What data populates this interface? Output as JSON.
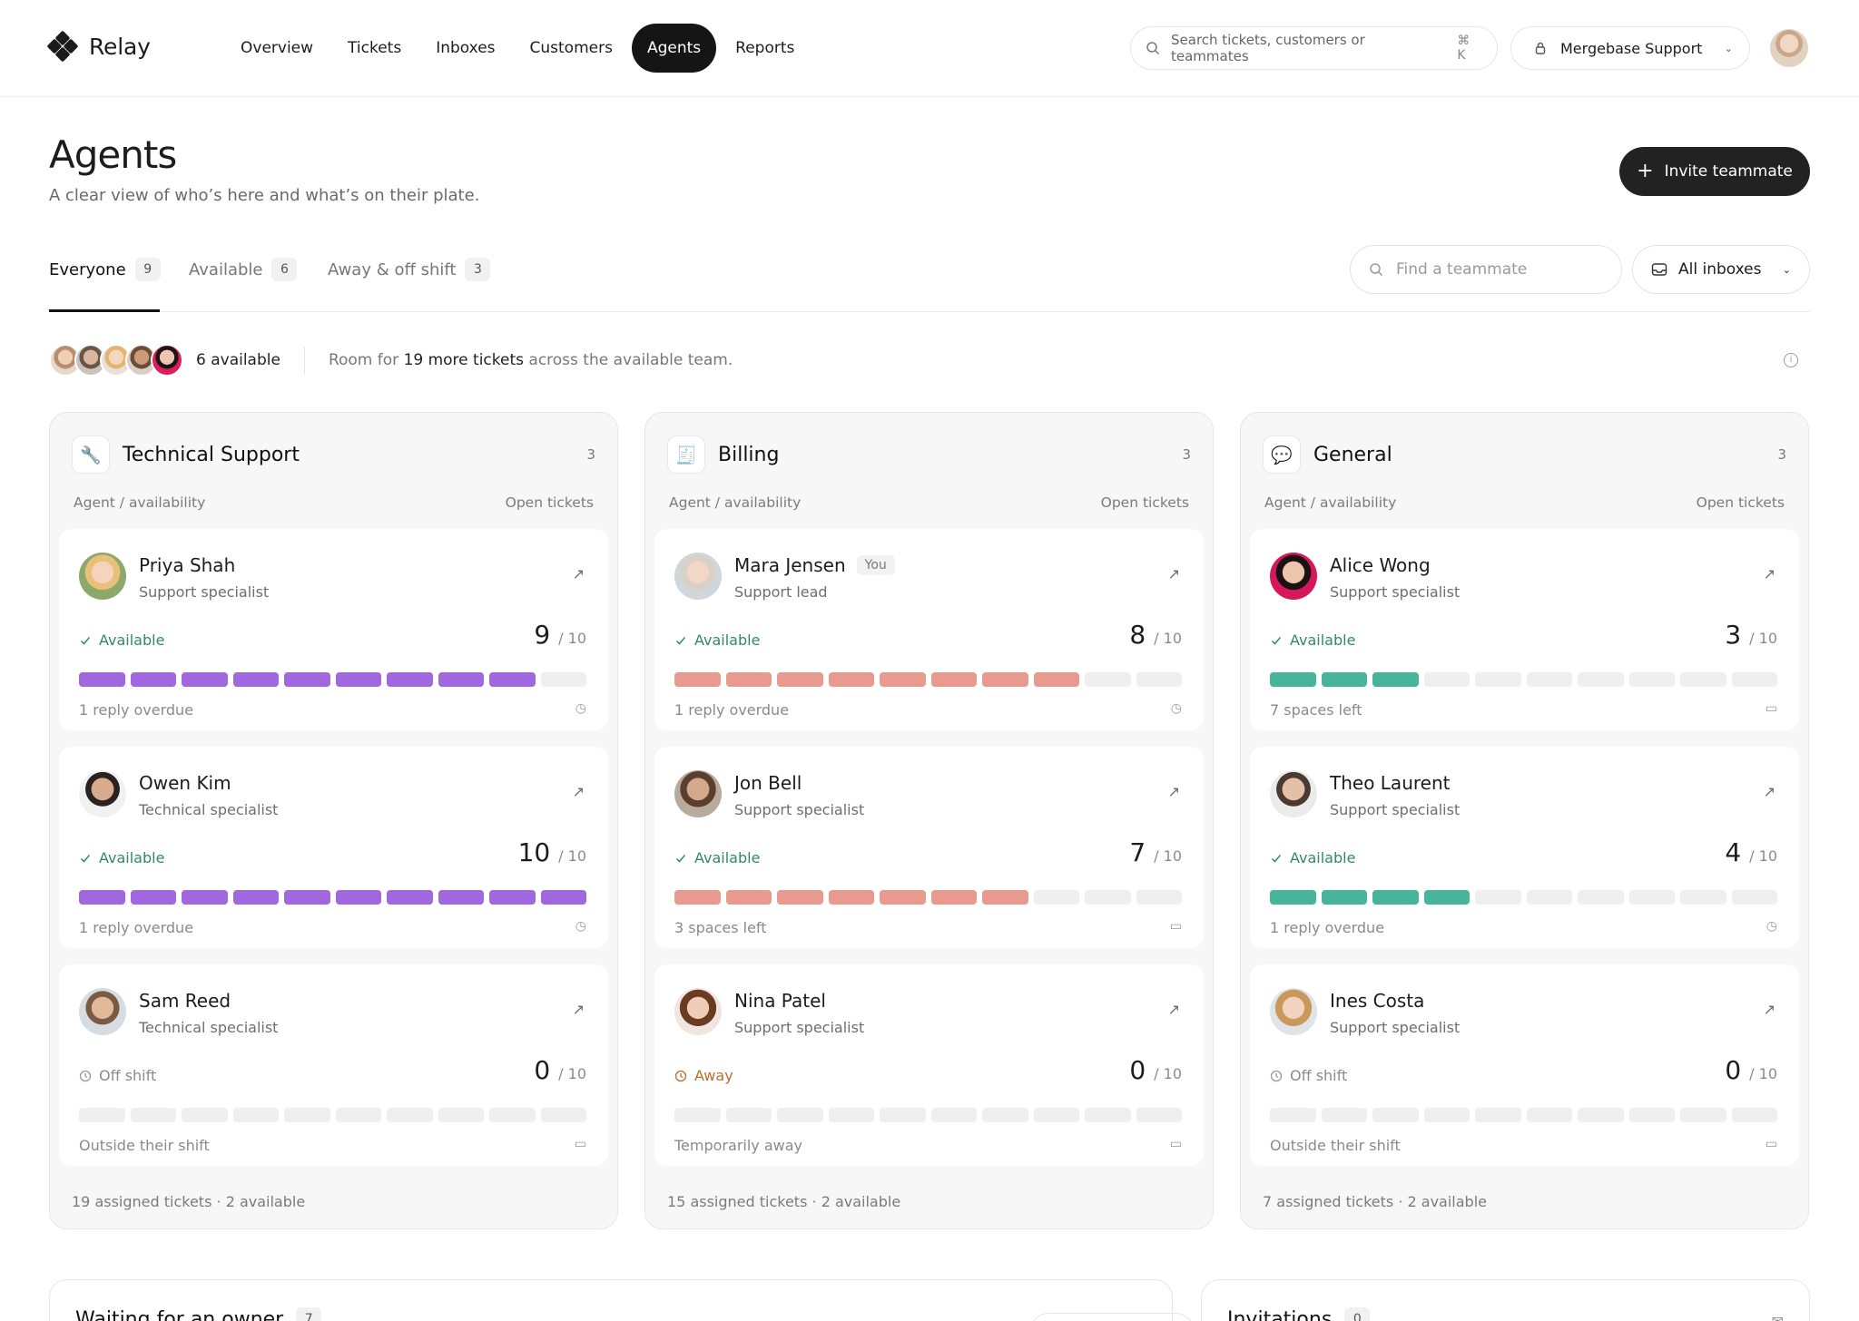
{
  "app": {
    "name": "Relay"
  },
  "nav": {
    "items": [
      "Overview",
      "Tickets",
      "Inboxes",
      "Customers",
      "Agents",
      "Reports"
    ],
    "active": "Agents"
  },
  "search": {
    "placeholder": "Search tickets, customers or teammates",
    "shortcut": "⌘ K"
  },
  "workspace": {
    "name": "Mergebase Support"
  },
  "header": {
    "title": "Agents",
    "subtitle": "A clear view of who’s here and what’s on their plate.",
    "invite_label": "Invite teammate"
  },
  "tabs": [
    {
      "label": "Everyone",
      "count": "9"
    },
    {
      "label": "Available",
      "count": "6"
    },
    {
      "label": "Away & off shift",
      "count": "3"
    }
  ],
  "filters": {
    "find_placeholder": "Find a teammate",
    "inbox_label": "All inboxes"
  },
  "summary": {
    "available_label": "6 available",
    "text_pre": "Room for",
    "text_bold": "19 more tickets",
    "text_post": "across the available team."
  },
  "colors": {
    "technical": "#a067df",
    "billing": "#e89a8e",
    "general": "#48b49a",
    "available": "#2e8a66",
    "away": "#c06a2e"
  },
  "groups": [
    {
      "name": "Technical Support",
      "count": "3",
      "icon": "wrench-icon",
      "col_agent": "Agent / availability",
      "col_tickets": "Open tickets",
      "footer": "19 assigned tickets",
      "footer_available": "2 available",
      "agents": [
        {
          "name": "Priya Shah",
          "role": "Support specialist",
          "status": "Available",
          "load": "9",
          "cap": "/ 10",
          "note": "1 reply overdue",
          "filled": 9
        },
        {
          "name": "Owen Kim",
          "role": "Technical specialist",
          "status": "Available",
          "load": "10",
          "cap": "/ 10",
          "note": "1 reply overdue",
          "filled": 10
        },
        {
          "name": "Sam Reed",
          "role": "Technical specialist",
          "status": "Off shift",
          "load": "0",
          "cap": "/ 10",
          "note": "Outside their shift",
          "filled": 0
        }
      ]
    },
    {
      "name": "Billing",
      "count": "3",
      "icon": "receipt-icon",
      "col_agent": "Agent / availability",
      "col_tickets": "Open tickets",
      "footer": "15 assigned tickets",
      "footer_available": "2 available",
      "agents": [
        {
          "name": "Mara Jensen",
          "you": "You",
          "role": "Support lead",
          "status": "Available",
          "load": "8",
          "cap": "/ 10",
          "note": "1 reply overdue",
          "filled": 8
        },
        {
          "name": "Jon Bell",
          "role": "Support specialist",
          "status": "Available",
          "load": "7",
          "cap": "/ 10",
          "note": "3 spaces left",
          "filled": 7
        },
        {
          "name": "Nina Patel",
          "role": "Support specialist",
          "status": "Away",
          "load": "0",
          "cap": "/ 10",
          "note": "Temporarily away",
          "filled": 0
        }
      ]
    },
    {
      "name": "General",
      "count": "3",
      "icon": "chat-icon",
      "col_agent": "Agent / availability",
      "col_tickets": "Open tickets",
      "footer": "7 assigned tickets",
      "footer_available": "2 available",
      "agents": [
        {
          "name": "Alice Wong",
          "role": "Support specialist",
          "status": "Available",
          "load": "3",
          "cap": "/ 10",
          "note": "7 spaces left",
          "filled": 3
        },
        {
          "name": "Theo Laurent",
          "role": "Support specialist",
          "status": "Available",
          "load": "4",
          "cap": "/ 10",
          "note": "1 reply overdue",
          "filled": 4
        },
        {
          "name": "Ines Costa",
          "role": "Support specialist",
          "status": "Off shift",
          "load": "0",
          "cap": "/ 10",
          "note": "Outside their shift",
          "filled": 0
        }
      ]
    }
  ],
  "panels": [
    {
      "title": "Waiting for an owner",
      "count": "7"
    },
    {
      "title": "Invitations",
      "count": "0"
    }
  ]
}
